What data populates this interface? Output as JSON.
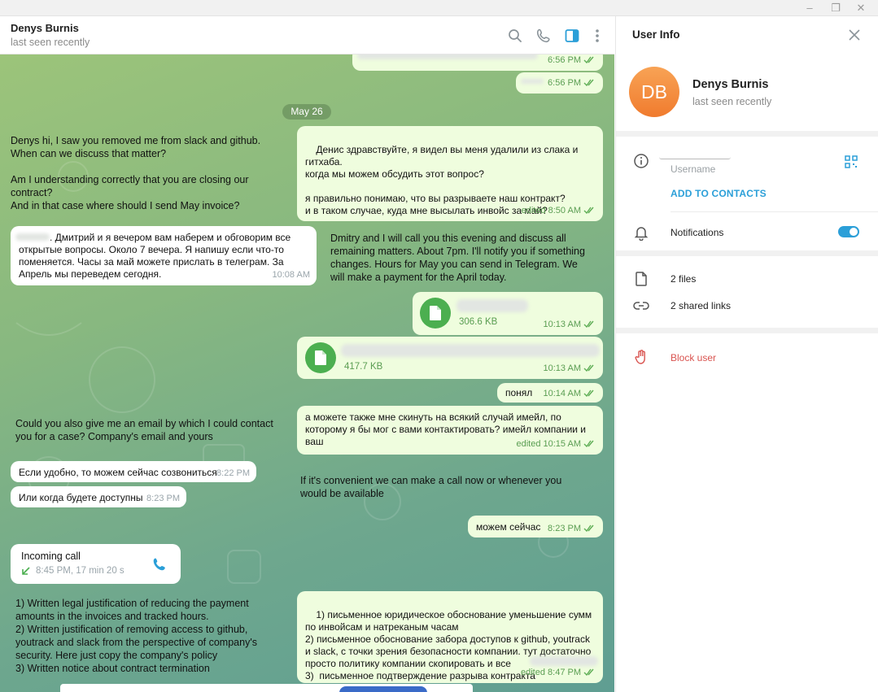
{
  "window": {
    "controls": {
      "minimize": "–",
      "restore": "❐",
      "close": "✕"
    }
  },
  "chat_header": {
    "name": "Denys Burnis",
    "status": "last seen recently"
  },
  "chat": {
    "top_times": [
      "6:56 PM",
      "6:56 PM"
    ],
    "date_separator": "May 26",
    "messages": {
      "m1_in": "Denys hi, I saw you removed me from slack and github.\nWhen can we discuss that matter?\n\nAm I understanding correctly that you are closing our contract?\nAnd in that case where should I send May invoice?",
      "m1_out": "Денис здравствуйте, я видел вы меня удалили из слака и гитхаба.\nкогда мы можем обсудить этот вопрос?\n\nя правильно понимаю, что вы разрываете наш контракт?\nи в таком случае, куда мне высылать инвойс за май?",
      "m1_out_time": "edited 8:50 AM",
      "m2_in": ". Дмитрий и я вечером вам наберем и обговорим все открытые вопросы. Около 7 вечера. Я напишу если что-то поменяется. Часы за май можете прислать в телеграм. За Апрель мы переведем сегодня.",
      "m2_in_time": "10:08 AM",
      "m2_trans": "Dmitry and I will call you this evening and discuss all remaining matters. About 7pm. I'll notify you if something changes. Hours for May you can send in Telegram. We will make a payment for the April today.",
      "file1_size": "306.6 KB",
      "file1_time": "10:13 AM",
      "file2_size": "417.7 KB",
      "file2_time": "10:13 AM",
      "ok_text": "понял",
      "ok_time": "10:14 AM",
      "m3_trans": "Could you also give me an email by which I could contact you for a case? Company's email and yours",
      "m3_out": "а можете также мне скинуть на всякий случай имейл, по которому я бы мог с вами контактировать? имейл компании и ваш",
      "m3_out_time": "edited 10:15 AM",
      "m4_in": "Если удобно, то можем сейчас созвониться",
      "m4_in_time": "8:22 PM",
      "m5_in": "Или когда будете доступны",
      "m5_in_time": "8:23 PM",
      "m45_trans": "If it's convenient we can make a call now or whenever you would be available",
      "m6_out": "можем сейчас",
      "m6_out_time": "8:23 PM",
      "call_title": "Incoming call",
      "call_detail": "8:45 PM, 17 min 20 s",
      "m7_trans": "1) Written legal justification of reducing the payment amounts in the invoices and tracked hours.\n2) Written justification of removing access to github, youtrack and slack from the perspective of company's security. Here just copy the company's policy\n3) Written notice about contract termination",
      "m7_out": "1) письменное юридическое обоснование уменьшение сумм по инвойсам и натреканым часам\n2) письменное обоснование забора доступов к github, youtrack и slack, с точки зрения безопасности компании. тут достаточно просто политику компании скопировать и все\n3)  письменное подтверждение разрыва контракта",
      "m7_out_time": "edited 8:47 PM"
    }
  },
  "user_info": {
    "title": "User Info",
    "avatar_initials": "DB",
    "name": "Denys Burnis",
    "status": "last seen recently",
    "username_label": "Username",
    "add_to_contacts": "ADD TO CONTACTS",
    "notifications_label": "Notifications",
    "notifications_on": true,
    "files": "2 files",
    "links": "2 shared links",
    "block": "Block user"
  },
  "colors": {
    "accent": "#2b9fd8",
    "outgoing_bubble": "#effdde",
    "danger": "#d9534f",
    "avatar": "#f28c3b"
  },
  "icons": [
    "search-icon",
    "phone-icon",
    "sidebar-toggle-icon",
    "more-vert-icon",
    "close-icon",
    "info-icon",
    "qr-code-icon",
    "bell-icon",
    "file-icon",
    "link-icon",
    "block-hand-icon",
    "double-check-icon",
    "call-icon",
    "incoming-arrow-icon"
  ]
}
